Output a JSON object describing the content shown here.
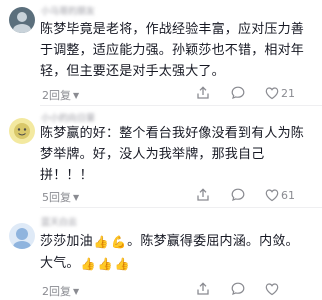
{
  "comments": [
    {
      "username": "小马哥的朋友",
      "lines": [
        "陈梦毕竟是老将，作战经验丰富，应对压力善",
        "于调整，适应能力强。孙颖莎也不错，相对年",
        "轻，但主要还是对手太强大了。"
      ],
      "reply_label": "2回复",
      "like_count": "21",
      "avatar_color": "#5b6f7c"
    },
    {
      "username": "小小的向日葵",
      "lines": [
        "陈梦赢的好：整个看台我好像没看到有人为陈",
        "梦举牌。好，没人为我举牌，那我自己",
        "拼！！！"
      ],
      "reply_label": "5回复",
      "like_count": "61",
      "avatar_color": "#d9c86a"
    },
    {
      "username": "蓝天白云",
      "line1_a": "莎莎加油",
      "line1_b": "。陈梦赢得委屈内涵。内敛。",
      "line2": "大气。",
      "reply_label": "2回复",
      "like_count": "",
      "avatar_color": "#8fb4de"
    }
  ],
  "icons": {
    "emoji_line1": [
      "thumbs-up",
      "flexed-bicep"
    ],
    "emoji_line2": [
      "thumbs-up",
      "thumbs-up",
      "thumbs-up"
    ],
    "actions": [
      "share-icon",
      "chat-icon",
      "heart-icon"
    ]
  }
}
